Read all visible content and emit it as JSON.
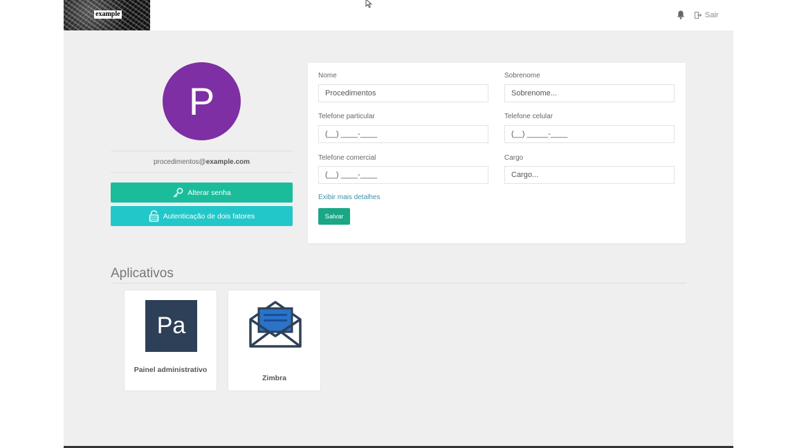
{
  "header": {
    "logo_text": "example",
    "logout_label": "Sair"
  },
  "profile": {
    "avatar_letter": "P",
    "avatar_color": "#7d2fa3",
    "email_user": "procedimentos@",
    "email_domain": "example.com",
    "change_password_label": "Alterar senha",
    "two_factor_label": "Autenticação de dois fatores"
  },
  "form": {
    "nome_label": "Nome",
    "nome_value": "Procedimentos",
    "sobrenome_label": "Sobrenome",
    "sobrenome_placeholder": "Sobrenome...",
    "tel_particular_label": "Telefone particular",
    "tel_particular_mask": "(__) ____-____",
    "tel_celular_label": "Telefone celular",
    "tel_celular_mask": "(__) _____-____",
    "tel_comercial_label": "Telefone comercial",
    "tel_comercial_mask": "(__) ____-____",
    "cargo_label": "Cargo",
    "cargo_placeholder": "Cargo...",
    "more_details_link": "Exibir mais detalhes",
    "save_label": "Salvar"
  },
  "apps": {
    "title": "Aplicativos",
    "items": [
      {
        "icon_text": "Pa",
        "name": "Painel administrativo",
        "icon": "panel-icon"
      },
      {
        "name": "Zimbra",
        "icon": "open-envelope-icon"
      }
    ]
  },
  "colors": {
    "primary_green": "#1bbc9b",
    "teal": "#22c7c9",
    "save_green": "#1aa785",
    "link_blue": "#3a8fa8",
    "panel_dark": "#2e4057"
  }
}
